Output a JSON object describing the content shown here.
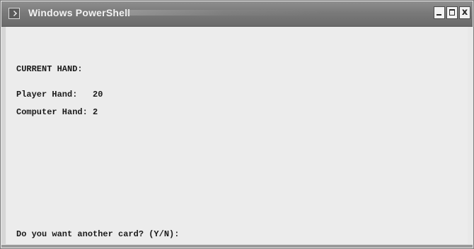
{
  "window": {
    "title": "Windows PowerShell",
    "minimize_icon": "minimize-icon",
    "maximize_icon": "maximize-icon",
    "close_glyph": "x",
    "accent_color": "#7a7a7a"
  },
  "console": {
    "heading": "CURRENT HAND:",
    "player_hand": "Player Hand:   20",
    "computer_hand": "Computer Hand: 2",
    "prompt": "Do you want another card? (Y/N):"
  }
}
